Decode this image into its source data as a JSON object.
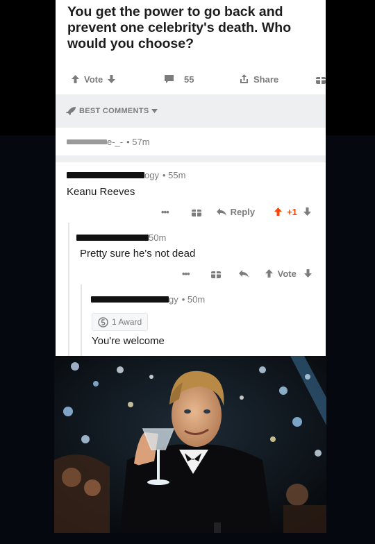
{
  "post": {
    "title": "You get the power to go back and prevent one celebrity's death. Who would you choose?",
    "vote_label": "Vote",
    "comment_count": "55",
    "share_label": "Share"
  },
  "sort": {
    "label": "BEST COMMENTS"
  },
  "comments": [
    {
      "user_fragment": "e-_-",
      "time": "• 57m"
    },
    {
      "user_fragment": "ogy",
      "time": "• 55m",
      "body": "Keanu Reeves",
      "more": "•••",
      "reply_label": "Reply",
      "score": "+1"
    },
    {
      "time": "50m",
      "body": "Pretty sure he's not dead",
      "more": "•••",
      "vote_label": "Vote"
    },
    {
      "user_fragment": "gy",
      "time": "• 50m",
      "award_label": "1 Award",
      "body": "You're welcome"
    }
  ],
  "colors": {
    "upvote": "#ff4500",
    "muted": "#7c7c7c",
    "text": "#1c1c1c",
    "divider": "#edeff1"
  },
  "icons": [
    "upvote-arrow-icon",
    "downvote-arrow-icon",
    "comment-bubble-icon",
    "share-icon",
    "gift-icon",
    "rocket-icon",
    "chevron-down-icon",
    "reply-arrow-icon",
    "award-coin-icon"
  ]
}
